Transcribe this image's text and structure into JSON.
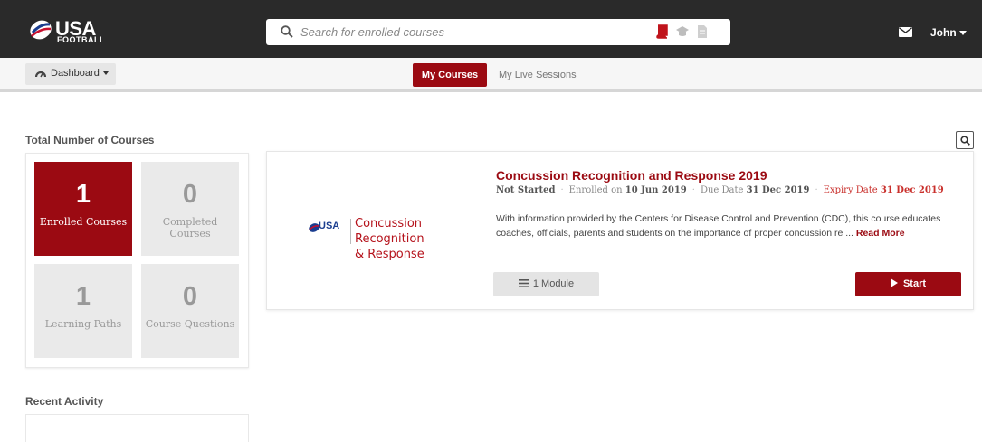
{
  "brand": {
    "word": "USA",
    "sub": "FOOTBALL"
  },
  "search": {
    "placeholder": "Search for enrolled courses"
  },
  "user": {
    "name": "John"
  },
  "subnav": {
    "dashboard_label": "Dashboard",
    "tabs": [
      {
        "label": "My Courses",
        "active": true
      },
      {
        "label": "My Live Sessions",
        "active": false
      }
    ]
  },
  "stats": {
    "title": "Total Number of Courses",
    "items": [
      {
        "value": "1",
        "label": "Enrolled Courses",
        "active": true
      },
      {
        "value": "0",
        "label": "Completed Courses",
        "active": false
      },
      {
        "value": "1",
        "label": "Learning Paths",
        "active": false
      },
      {
        "value": "0",
        "label": "Course Questions",
        "active": false
      }
    ]
  },
  "recent": {
    "title": "Recent Activity"
  },
  "course": {
    "thumb_brand": "USA",
    "thumb_line1": "Concussion Recognition",
    "thumb_line2": "& Response",
    "title": "Concussion Recognition and Response 2019",
    "status": "Not Started",
    "enrolled_label": "Enrolled on",
    "enrolled_date": "10 Jun 2019",
    "due_label": "Due Date",
    "due_date": "31 Dec 2019",
    "expiry_label": "Expiry Date",
    "expiry_date": "31 Dec 2019",
    "description": "With information provided by the Centers for Disease Control and Prevention (CDC), this course educates coaches, officials, parents and students on the importance of proper concussion re ...",
    "read_more": "Read More",
    "module_label": "1 Module",
    "start_label": "Start"
  },
  "colors": {
    "topbar": "#2a2a2a",
    "accent": "#9b0a12",
    "book_icon": "#c0141c"
  },
  "icons": [
    "usa-football-logo",
    "search-icon",
    "book-icon",
    "graduation-icon",
    "document-icon",
    "mail-icon",
    "dashboard-icon",
    "list-icon",
    "play-icon"
  ]
}
